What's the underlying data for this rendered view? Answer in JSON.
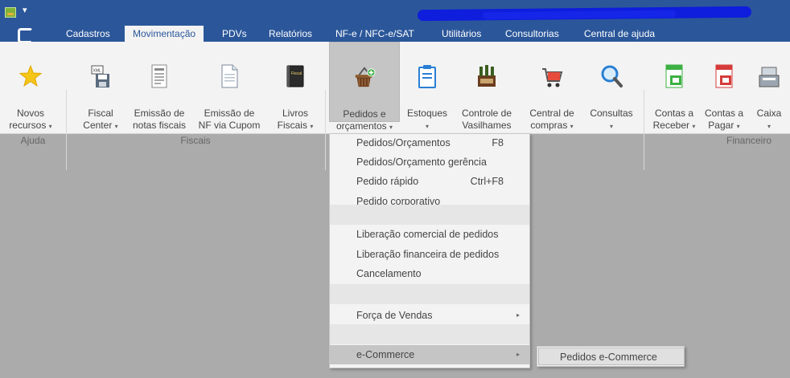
{
  "titlebar": {
    "qat_arrow": "▾"
  },
  "tabs": [
    {
      "label": "Cadastros"
    },
    {
      "label": "Movimentação"
    },
    {
      "label": "PDVs"
    },
    {
      "label": "Relatórios"
    },
    {
      "label": "NF-e / NFC-e/SAT"
    },
    {
      "label": "Utilitários"
    },
    {
      "label": "Consultorias"
    },
    {
      "label": "Central de ajuda"
    }
  ],
  "ribbon": {
    "buttons": [
      {
        "line1": "Novos",
        "line2": "recursos",
        "dropdown": true,
        "icon": "star-icon"
      },
      {
        "line1": "Fiscal",
        "line2": "Center",
        "dropdown": true,
        "icon": "xml-save-icon"
      },
      {
        "line1": "Emissão de",
        "line2": "notas fiscais",
        "dropdown": false,
        "icon": "document-icon"
      },
      {
        "line1": "Emissão de",
        "line2": "NF via Cupom",
        "dropdown": false,
        "icon": "page-icon"
      },
      {
        "line1": "Livros",
        "line2": "Fiscais",
        "dropdown": true,
        "icon": "fiscal-book-icon"
      },
      {
        "line1": "Pedidos e",
        "line2": "orçamentos",
        "dropdown": true,
        "icon": "basket-icon"
      },
      {
        "line1": "Estoques",
        "line2": "",
        "dropdown": true,
        "icon": "clipboard-icon"
      },
      {
        "line1": "Controle de",
        "line2": "Vasilhames",
        "dropdown": false,
        "icon": "bottles-icon"
      },
      {
        "line1": "Central de",
        "line2": "compras",
        "dropdown": true,
        "icon": "cart-icon"
      },
      {
        "line1": "Consultas",
        "line2": "",
        "dropdown": true,
        "icon": "magnifier-icon"
      },
      {
        "line1": "Contas a",
        "line2": "Receber",
        "dropdown": true,
        "icon": "receipt-icon"
      },
      {
        "line1": "Contas a",
        "line2": "Pagar",
        "dropdown": true,
        "icon": "paid-icon"
      },
      {
        "line1": "Caixa",
        "line2": "",
        "dropdown": true,
        "icon": "cash-register-icon"
      }
    ],
    "groups": {
      "ajuda": "Ajuda",
      "fiscais": "Fiscais",
      "financeiro": "Financeiro"
    },
    "caret": "▾"
  },
  "menu": {
    "items": [
      {
        "label": "Pedidos/Orçamentos",
        "shortcut": "F8"
      },
      {
        "label": "Pedidos/Orçamento gerência",
        "shortcut": ""
      },
      {
        "label": "Pedido rápido",
        "shortcut": "Ctrl+F8"
      },
      {
        "label": "Pedido corporativo",
        "shortcut": ""
      },
      {
        "label": "Liberação comercial de pedidos",
        "shortcut": ""
      },
      {
        "label": "Liberação financeira de pedidos",
        "shortcut": ""
      },
      {
        "label": "Cancelamento",
        "shortcut": ""
      },
      {
        "label": "Força de Vendas",
        "shortcut": ""
      },
      {
        "label": "e-Commerce",
        "shortcut": ""
      }
    ],
    "submenu_arrow": "▸"
  },
  "submenu": {
    "items": [
      {
        "label": "Pedidos e-Commerce"
      }
    ]
  }
}
